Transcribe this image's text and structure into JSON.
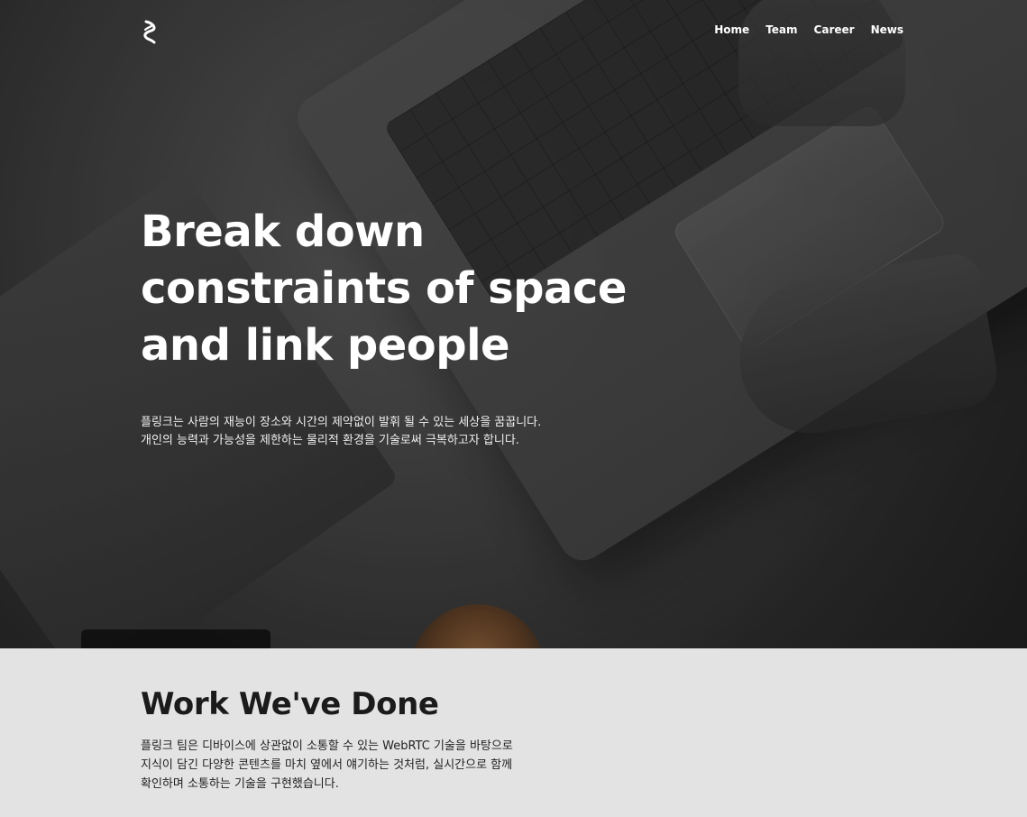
{
  "header": {
    "logo_icon": "logo-icon",
    "nav": [
      {
        "label": "Home"
      },
      {
        "label": "Team"
      },
      {
        "label": "Career"
      },
      {
        "label": "News"
      }
    ]
  },
  "hero": {
    "title_lines": [
      "Break down",
      "constraints of space",
      "and link people"
    ],
    "subtitle_lines": [
      "플링크는 사람의 재능이 장소와 시간의 제약없이 발휘 될 수 있는 세상을 꿈꿉니다.",
      "개인의 능력과 가능성을 제한하는 물리적 환경을 기술로써 극복하고자 합니다."
    ]
  },
  "work": {
    "title": "Work We've Done",
    "desc_lines": [
      "플링크 팀은 디바이스에 상관없이 소통할 수 있는 WebRTC 기술을 바탕으로",
      "지식이 담긴 다양한 콘텐츠를 마치 옆에서 얘기하는 것처럼, 실시간으로 함께",
      "확인하며 소통하는 기술을 구현했습니다."
    ]
  },
  "colors": {
    "hero_text": "#ffffff",
    "work_bg": "#e3e3e3",
    "work_text": "#1b1b1b"
  }
}
